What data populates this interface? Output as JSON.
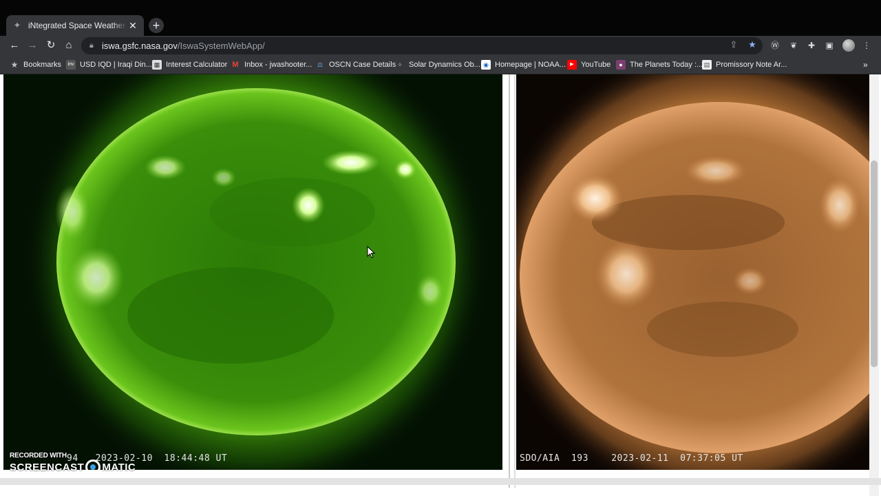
{
  "tab": {
    "title": "iNtegrated Space Weather Analy",
    "favicon": "nasa-favicon-icon"
  },
  "omnibox": {
    "host": "iswa.gsfc.nasa.gov",
    "path": "/IswaSystemWebApp/"
  },
  "bookmarks": [
    {
      "label": "Bookmarks",
      "icon": "star-icon"
    },
    {
      "label": "USD IQD | Iraqi Din...",
      "icon": "inv-icon"
    },
    {
      "label": "Interest Calculator",
      "icon": "calculator-icon"
    },
    {
      "label": "Inbox - jwashooter...",
      "icon": "gmail-icon"
    },
    {
      "label": "OSCN Case Details",
      "icon": "oscn-icon"
    },
    {
      "label": "Solar Dynamics Ob...",
      "icon": "sdo-icon"
    },
    {
      "label": "Homepage | NOAA...",
      "icon": "noaa-icon"
    },
    {
      "label": "YouTube",
      "icon": "youtube-icon"
    },
    {
      "label": "The Planets Today :...",
      "icon": "planets-icon"
    },
    {
      "label": "Promissory Note Ar...",
      "icon": "document-icon"
    }
  ],
  "panels": {
    "left": {
      "instrument": "94",
      "timestamp": "2023-02-10  18:44:48 UT",
      "color": "#5cc21a"
    },
    "right": {
      "instrument": "SDO/AIA  193",
      "timestamp": "2023-02-11  07:37:05 UT",
      "color": "#c8844a"
    }
  },
  "watermark": {
    "line1": "RECORDED WITH",
    "line2a": "SCREENCAST",
    "line2b": "MATIC"
  }
}
